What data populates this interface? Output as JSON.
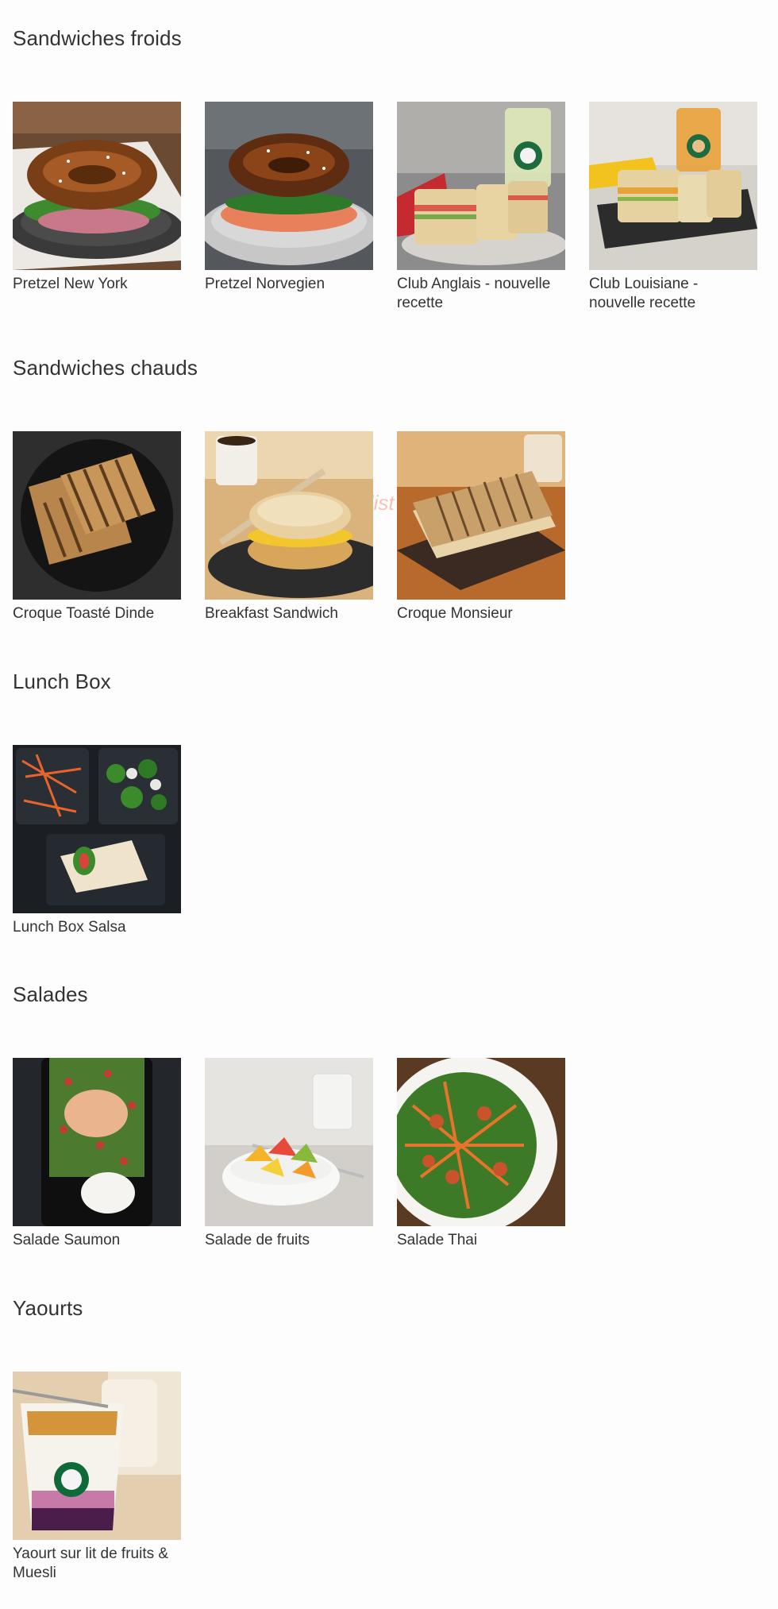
{
  "sections": [
    {
      "title": "Sandwiches froids",
      "items": [
        {
          "label": "Pretzel New York",
          "icon": "pretzel-sandwich-photo"
        },
        {
          "label": "Pretzel Norvegien",
          "icon": "pretzel-salmon-photo"
        },
        {
          "label": "Club Anglais - nouvelle recette",
          "icon": "club-sandwich-photo"
        },
        {
          "label": "Club Louisiane - nouvelle recette",
          "icon": "club-sandwich-photo"
        }
      ]
    },
    {
      "title": "Sandwiches chauds",
      "items": [
        {
          "label": "Croque Toasté Dinde",
          "icon": "panini-photo"
        },
        {
          "label": "Breakfast Sandwich",
          "icon": "muffin-sandwich-photo"
        },
        {
          "label": "Croque Monsieur",
          "icon": "grilled-sandwich-photo"
        }
      ]
    },
    {
      "title": "Lunch Box",
      "items": [
        {
          "label": "Lunch Box Salsa",
          "icon": "lunch-box-photo"
        }
      ]
    },
    {
      "title": "Salades",
      "items": [
        {
          "label": "Salade Saumon",
          "icon": "salmon-salad-photo"
        },
        {
          "label": "Salade de fruits",
          "icon": "fruit-salad-photo"
        },
        {
          "label": "Salade Thai",
          "icon": "thai-salad-photo"
        }
      ]
    },
    {
      "title": "Yaourts",
      "items": [
        {
          "label": "Yaourt sur lit de fruits & Muesli",
          "icon": "yogurt-cup-photo"
        }
      ]
    }
  ],
  "watermark": "eat-list",
  "colors": {
    "background": "#fefdfd",
    "text": "#333333",
    "watermark": "#ec9478"
  }
}
